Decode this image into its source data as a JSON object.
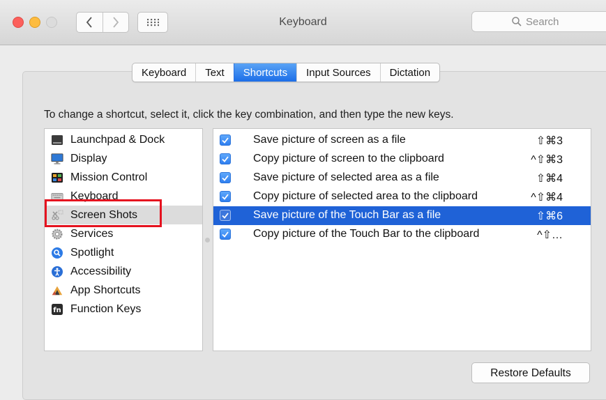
{
  "window": {
    "title": "Keyboard",
    "search_placeholder": "Search"
  },
  "tabs": [
    {
      "label": "Keyboard",
      "selected": false
    },
    {
      "label": "Text",
      "selected": false
    },
    {
      "label": "Shortcuts",
      "selected": true
    },
    {
      "label": "Input Sources",
      "selected": false
    },
    {
      "label": "Dictation",
      "selected": false
    }
  ],
  "instruction": "To change a shortcut, select it, click the key combination, and then type the new keys.",
  "categories": [
    {
      "label": "Launchpad & Dock",
      "icon": "launchpad-dock-icon"
    },
    {
      "label": "Display",
      "icon": "display-icon"
    },
    {
      "label": "Mission Control",
      "icon": "mission-control-icon"
    },
    {
      "label": "Keyboard",
      "icon": "keyboard-icon"
    },
    {
      "label": "Screen Shots",
      "icon": "screenshot-icon",
      "selected": true
    },
    {
      "label": "Services",
      "icon": "gear-icon"
    },
    {
      "label": "Spotlight",
      "icon": "spotlight-icon"
    },
    {
      "label": "Accessibility",
      "icon": "accessibility-icon"
    },
    {
      "label": "App Shortcuts",
      "icon": "app-shortcuts-icon"
    },
    {
      "label": "Function Keys",
      "icon": "fn-key-icon"
    }
  ],
  "shortcuts": [
    {
      "label": "Save picture of screen as a file",
      "key": "⇧⌘3",
      "checked": true
    },
    {
      "label": "Copy picture of screen to the clipboard",
      "key": "^⇧⌘3",
      "checked": true
    },
    {
      "label": "Save picture of selected area as a file",
      "key": "⇧⌘4",
      "checked": true
    },
    {
      "label": "Copy picture of selected area to the clipboard",
      "key": "^⇧⌘4",
      "checked": true
    },
    {
      "label": "Save picture of the Touch Bar as a file",
      "key": "⇧⌘6",
      "checked": true,
      "selected": true
    },
    {
      "label": "Copy picture of the Touch Bar to the clipboard",
      "key": "^⇧…",
      "checked": true
    }
  ],
  "restore_button": "Restore Defaults",
  "colors": {
    "selection_blue": "#1f62d7",
    "tab_selected_blue": "#2f7ff0",
    "annotation_red": "#e5121f"
  }
}
